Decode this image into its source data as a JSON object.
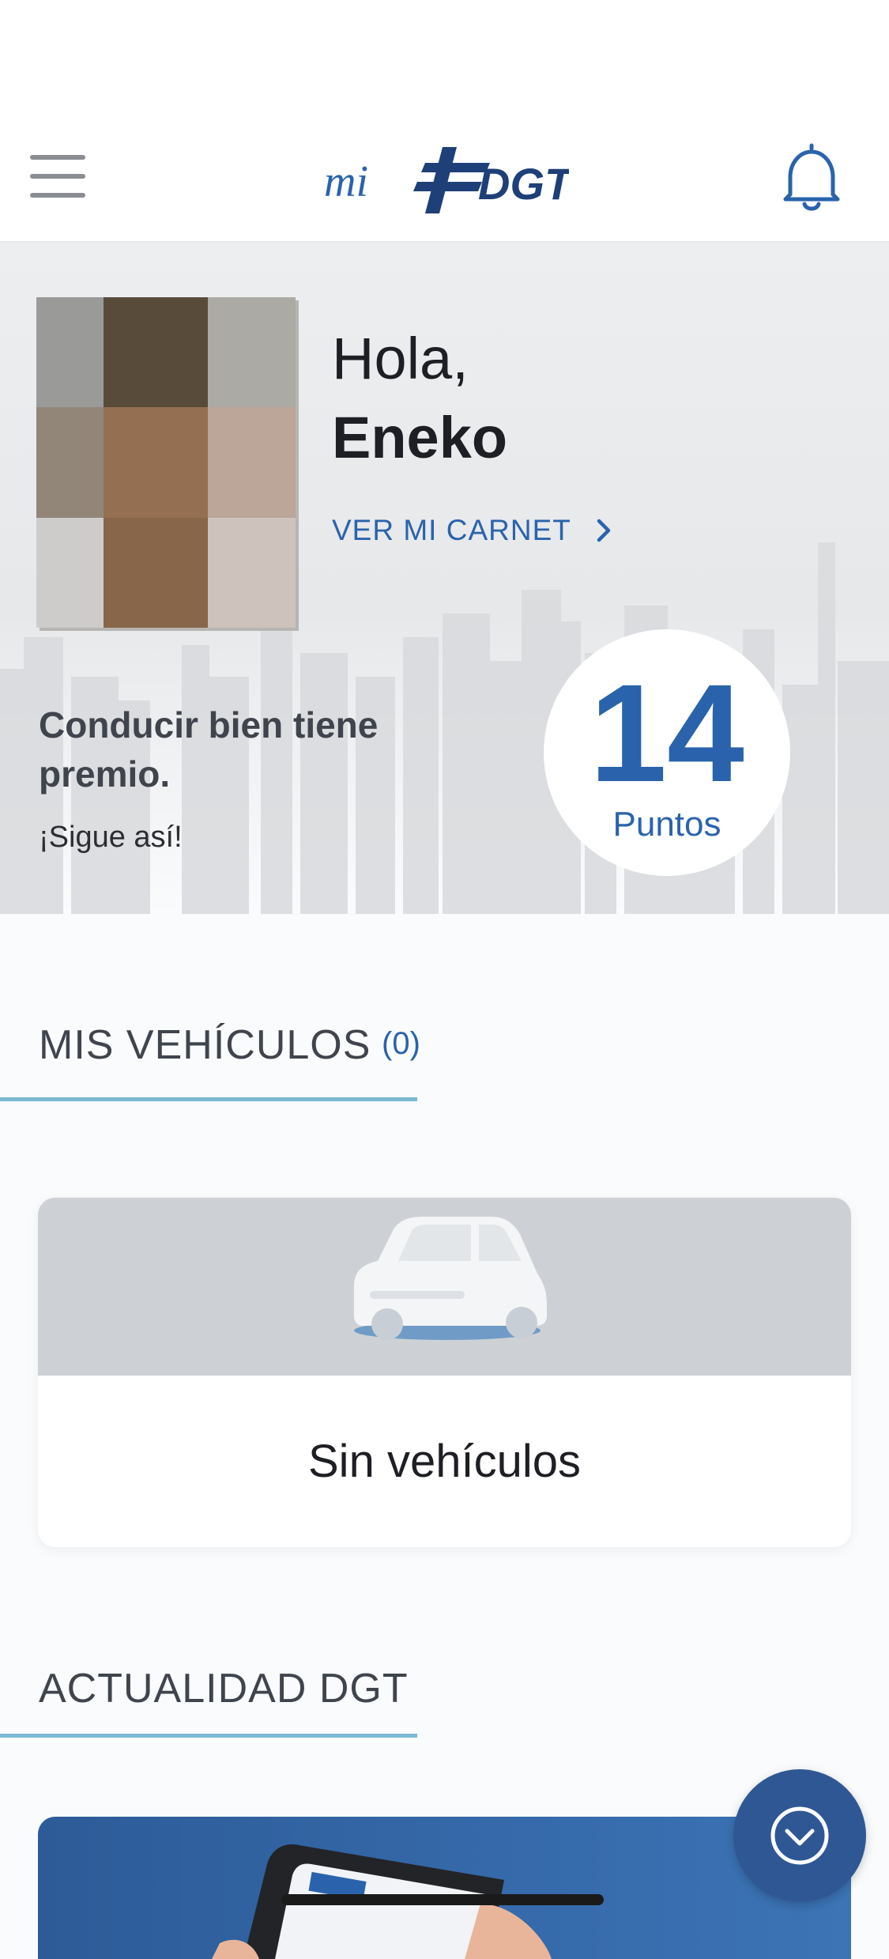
{
  "header": {
    "logo_text": "mi DGT",
    "icons": {
      "menu": "hamburger-menu-icon",
      "notifications": "bell-icon"
    }
  },
  "profile": {
    "greeting": "Hola,",
    "name": "Eneko",
    "carnet_link": "VER MI CARNET",
    "avatar_colors": [
      "#9a9a98",
      "#584b3a",
      "#abaaa4",
      "#928679",
      "#946f51",
      "#bba699",
      "#cdcccb",
      "#87664a",
      "#cdc2bc"
    ]
  },
  "promo": {
    "title": "Conducir bien tiene premio.",
    "subtitle": "¡Sigue así!"
  },
  "points": {
    "value": "14",
    "label": "Puntos"
  },
  "vehicles": {
    "heading": "MIS VEHÍCULOS",
    "count": "(0)",
    "empty_text": "Sin vehículos"
  },
  "news": {
    "heading": "ACTUALIDAD DGT"
  },
  "colors": {
    "accent_blue": "#2a63ac",
    "underline": "#7bb8d4",
    "fab": "#2f5794"
  }
}
